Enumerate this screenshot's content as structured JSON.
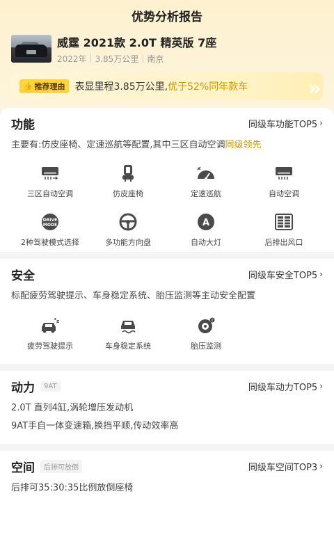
{
  "header": {
    "title": "优势分析报告"
  },
  "car": {
    "name": "威霆 2021款 2.0T 精英版 7座",
    "year": "2022年",
    "mileage": "3.85万公里",
    "city": "南京"
  },
  "reason": {
    "badge": "推荐理由",
    "text": "表显里程3.85万公里,",
    "highlight": "优于52%同年款车"
  },
  "function": {
    "title": "功能",
    "link": "同级车功能TOP5",
    "desc": "主要有:仿皮座椅、定速巡航等配置,其中三区自动空调",
    "desc_highlight": "同级领先",
    "items": [
      {
        "label": "三区自动空调",
        "icon": "ac-three-zone-icon"
      },
      {
        "label": "仿皮座椅",
        "icon": "seat-icon"
      },
      {
        "label": "定速巡航",
        "icon": "cruise-icon"
      },
      {
        "label": "自动空调",
        "icon": "auto-ac-icon"
      },
      {
        "label": "2种驾驶模式选择",
        "icon": "drive-mode-icon"
      },
      {
        "label": "多功能方向盘",
        "icon": "steering-wheel-icon"
      },
      {
        "label": "自动大灯",
        "icon": "headlight-icon"
      },
      {
        "label": "后排出风口",
        "icon": "rear-vent-icon"
      }
    ]
  },
  "safety": {
    "title": "安全",
    "link": "同级车安全TOP5",
    "desc": "标配疲劳驾驶提示、车身稳定系统、胎压监测等主动安全配置",
    "items": [
      {
        "label": "疲劳驾驶提示",
        "icon": "fatigue-icon"
      },
      {
        "label": "车身稳定系统",
        "icon": "stability-icon"
      },
      {
        "label": "胎压监测",
        "icon": "tire-pressure-icon"
      }
    ]
  },
  "power": {
    "title": "动力",
    "tag": "9AT",
    "link": "同级车动力TOP5",
    "line1": "2.0T 直列4缸,涡轮增压发动机",
    "line2": "9AT手自一体变速箱,换挡平顺,传动效率高"
  },
  "space": {
    "title": "空间",
    "tag": "后排可放倒",
    "link": "同级车空间TOP3",
    "desc": "后排可35:30:35比例放倒座椅"
  },
  "colors": {
    "accent": "#c79600",
    "badge": "#ffd23f",
    "icon": "#4a4a4a"
  }
}
